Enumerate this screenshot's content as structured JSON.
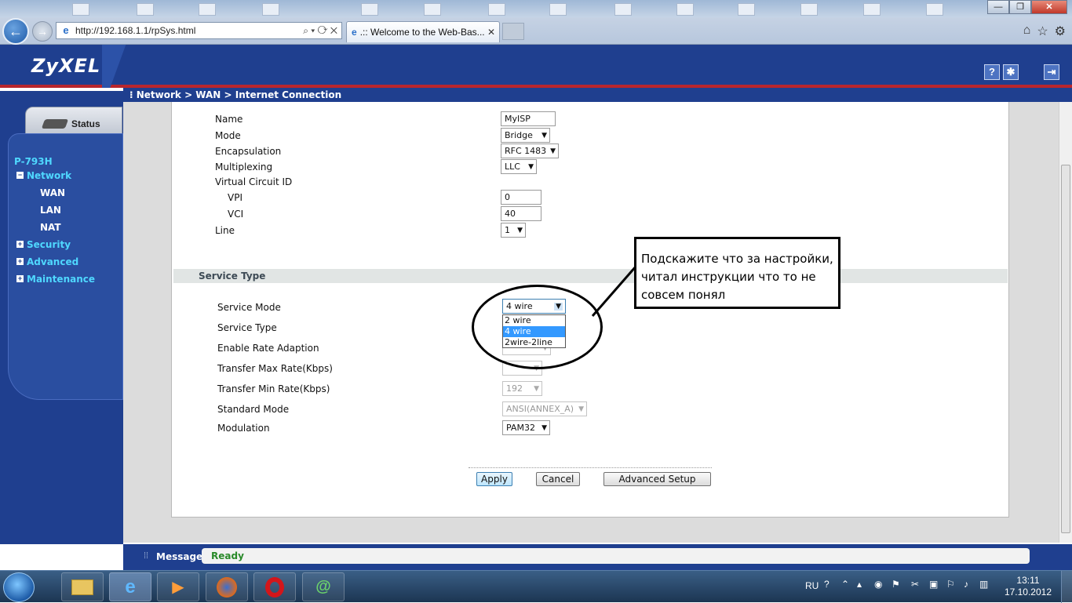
{
  "browser": {
    "url": "http://192.168.1.1/rpSys.html",
    "tab_title": ".:: Welcome to the Web-Bas...",
    "address_tools": "⌕ ▾ ⟳ ✕"
  },
  "router": {
    "brand": "ZyXEL",
    "breadcrumb": "Network > WAN > Internet Connection",
    "status_tab": "Status",
    "model": "P-793H",
    "nav": {
      "network": "Network",
      "wan": "WAN",
      "lan": "LAN",
      "nat": "NAT",
      "security": "Security",
      "advanced": "Advanced",
      "maintenance": "Maintenance"
    }
  },
  "wan_form": {
    "name_label": "Name",
    "name_value": "MyISP",
    "mode_label": "Mode",
    "mode_value": "Bridge",
    "encap_label": "Encapsulation",
    "encap_value": "RFC 1483",
    "mux_label": "Multiplexing",
    "mux_value": "LLC",
    "vc_label": "Virtual Circuit ID",
    "vpi_label": "VPI",
    "vpi_value": "0",
    "vci_label": "VCI",
    "vci_value": "40",
    "line_label": "Line",
    "line_value": "1"
  },
  "service": {
    "section_title": "Service Type",
    "mode_label": "Service Mode",
    "mode_value": "4 wire",
    "mode_options": [
      "2 wire",
      "4 wire",
      "2wire-2line"
    ],
    "type_label": "Service Type",
    "rate_adapt_label": "Enable Rate Adaption",
    "max_rate_label": "Transfer Max Rate(Kbps)",
    "min_rate_label": "Transfer Min Rate(Kbps)",
    "min_rate_value": "192",
    "std_mode_label": "Standard Mode",
    "std_mode_value": "ANSI(ANNEX_A)",
    "modulation_label": "Modulation",
    "modulation_value": "PAM32"
  },
  "buttons": {
    "apply": "Apply",
    "cancel": "Cancel",
    "advanced": "Advanced Setup"
  },
  "note": {
    "line1": "Подскажите  что за настройки,",
    "line2": "читал инструкции что то не",
    "line3": "совсем понял"
  },
  "message": {
    "label": "Message",
    "value": "Ready"
  },
  "taskbar": {
    "lang": "RU",
    "time": "13:11",
    "date": "17.10.2012"
  }
}
